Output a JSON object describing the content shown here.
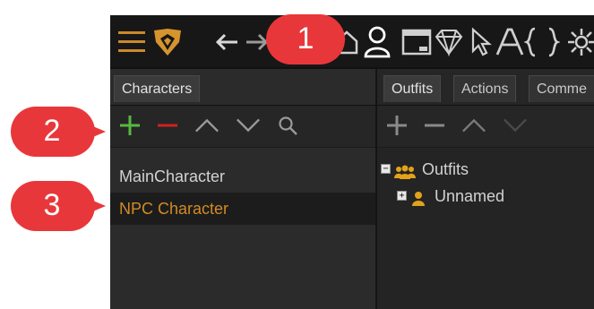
{
  "colors": {
    "accent": "#d28a25",
    "add": "#57b940",
    "remove": "#d32020",
    "callout": "#e8373a"
  },
  "toolbar": {
    "icons": [
      "menu-icon",
      "logo-icon",
      "back-icon",
      "forward-icon",
      "home-icon",
      "character-icon",
      "dialog-icon",
      "diamond-icon",
      "cursor-icon",
      "font-icon",
      "braces-icon",
      "settings-icon"
    ]
  },
  "left_panel": {
    "tab_label": "Characters",
    "characters": [
      "MainCharacter",
      "NPC Character"
    ],
    "selected_index": 1
  },
  "right_panel": {
    "tabs": [
      "Outfits",
      "Actions",
      "Comme"
    ],
    "tree": {
      "root_label": "Outfits",
      "child_label": "Unnamed"
    }
  },
  "callouts": [
    "1",
    "2",
    "3"
  ]
}
